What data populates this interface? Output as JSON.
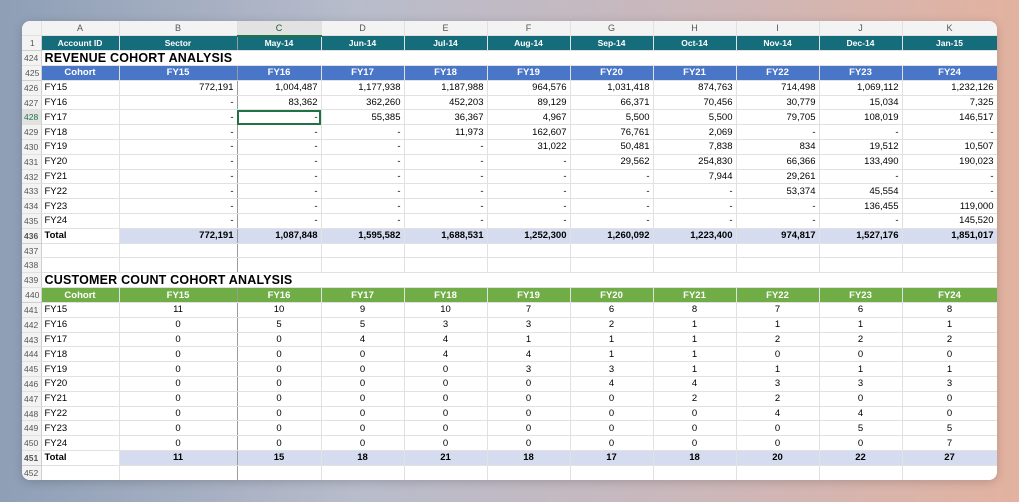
{
  "columns": [
    "A",
    "B",
    "C",
    "D",
    "E",
    "F",
    "G",
    "H",
    "I",
    "J",
    "K"
  ],
  "header_row": {
    "num": "1",
    "cells": [
      "Account ID",
      "Sector",
      "May-14",
      "Jun-14",
      "Jul-14",
      "Aug-14",
      "Sep-14",
      "Oct-14",
      "Nov-14",
      "Dec-14",
      "Jan-15"
    ]
  },
  "revenue": {
    "title_row": "424",
    "title": "REVENUE COHORT ANALYSIS",
    "header": {
      "num": "425",
      "cells": [
        "Cohort",
        "FY15",
        "FY16",
        "FY17",
        "FY18",
        "FY19",
        "FY20",
        "FY21",
        "FY22",
        "FY23",
        "FY24"
      ]
    },
    "rows": [
      {
        "num": "426",
        "cells": [
          "FY15",
          "772,191",
          "1,004,487",
          "1,177,938",
          "1,187,988",
          "964,576",
          "1,031,418",
          "874,763",
          "714,498",
          "1,069,112",
          "1,232,126"
        ]
      },
      {
        "num": "427",
        "cells": [
          "FY16",
          "-",
          "83,362",
          "362,260",
          "452,203",
          "89,129",
          "66,371",
          "70,456",
          "30,779",
          "15,034",
          "7,325"
        ]
      },
      {
        "num": "428",
        "cells": [
          "FY17",
          "-",
          "-",
          "55,385",
          "36,367",
          "4,967",
          "5,500",
          "5,500",
          "79,705",
          "108,019",
          "146,517"
        ]
      },
      {
        "num": "429",
        "cells": [
          "FY18",
          "-",
          "-",
          "-",
          "11,973",
          "162,607",
          "76,761",
          "2,069",
          "-",
          "-",
          "-"
        ]
      },
      {
        "num": "430",
        "cells": [
          "FY19",
          "-",
          "-",
          "-",
          "-",
          "31,022",
          "50,481",
          "7,838",
          "834",
          "19,512",
          "10,507"
        ]
      },
      {
        "num": "431",
        "cells": [
          "FY20",
          "-",
          "-",
          "-",
          "-",
          "-",
          "29,562",
          "254,830",
          "66,366",
          "133,490",
          "190,023"
        ]
      },
      {
        "num": "432",
        "cells": [
          "FY21",
          "-",
          "-",
          "-",
          "-",
          "-",
          "-",
          "7,944",
          "29,261",
          "-",
          "-"
        ]
      },
      {
        "num": "433",
        "cells": [
          "FY22",
          "-",
          "-",
          "-",
          "-",
          "-",
          "-",
          "-",
          "53,374",
          "45,554",
          "-"
        ]
      },
      {
        "num": "434",
        "cells": [
          "FY23",
          "-",
          "-",
          "-",
          "-",
          "-",
          "-",
          "-",
          "-",
          "136,455",
          "119,000"
        ]
      },
      {
        "num": "435",
        "cells": [
          "FY24",
          "-",
          "-",
          "-",
          "-",
          "-",
          "-",
          "-",
          "-",
          "-",
          "145,520"
        ]
      }
    ],
    "total": {
      "num": "436",
      "cells": [
        "Total",
        "772,191",
        "1,087,848",
        "1,595,582",
        "1,688,531",
        "1,252,300",
        "1,260,092",
        "1,223,400",
        "974,817",
        "1,527,176",
        "1,851,017"
      ]
    }
  },
  "blank_rows": [
    "437",
    "438"
  ],
  "customers": {
    "title_row": "439",
    "title": "CUSTOMER COUNT COHORT ANALYSIS",
    "header": {
      "num": "440",
      "cells": [
        "Cohort",
        "FY15",
        "FY16",
        "FY17",
        "FY18",
        "FY19",
        "FY20",
        "FY21",
        "FY22",
        "FY23",
        "FY24"
      ]
    },
    "rows": [
      {
        "num": "441",
        "cells": [
          "FY15",
          "11",
          "10",
          "9",
          "10",
          "7",
          "6",
          "8",
          "7",
          "6",
          "8"
        ]
      },
      {
        "num": "442",
        "cells": [
          "FY16",
          "0",
          "5",
          "5",
          "3",
          "3",
          "2",
          "1",
          "1",
          "1",
          "1"
        ]
      },
      {
        "num": "443",
        "cells": [
          "FY17",
          "0",
          "0",
          "4",
          "4",
          "1",
          "1",
          "1",
          "2",
          "2",
          "2"
        ]
      },
      {
        "num": "444",
        "cells": [
          "FY18",
          "0",
          "0",
          "0",
          "4",
          "4",
          "1",
          "1",
          "0",
          "0",
          "0"
        ]
      },
      {
        "num": "445",
        "cells": [
          "FY19",
          "0",
          "0",
          "0",
          "0",
          "3",
          "3",
          "1",
          "1",
          "1",
          "1"
        ]
      },
      {
        "num": "446",
        "cells": [
          "FY20",
          "0",
          "0",
          "0",
          "0",
          "0",
          "4",
          "4",
          "3",
          "3",
          "3"
        ]
      },
      {
        "num": "447",
        "cells": [
          "FY21",
          "0",
          "0",
          "0",
          "0",
          "0",
          "0",
          "2",
          "2",
          "0",
          "0"
        ]
      },
      {
        "num": "448",
        "cells": [
          "FY22",
          "0",
          "0",
          "0",
          "0",
          "0",
          "0",
          "0",
          "4",
          "4",
          "0"
        ]
      },
      {
        "num": "449",
        "cells": [
          "FY23",
          "0",
          "0",
          "0",
          "0",
          "0",
          "0",
          "0",
          "0",
          "5",
          "5"
        ]
      },
      {
        "num": "450",
        "cells": [
          "FY24",
          "0",
          "0",
          "0",
          "0",
          "0",
          "0",
          "0",
          "0",
          "0",
          "7"
        ]
      }
    ],
    "total": {
      "num": "451",
      "cells": [
        "Total",
        "11",
        "15",
        "18",
        "21",
        "18",
        "17",
        "18",
        "20",
        "22",
        "27"
      ]
    }
  },
  "last_row": "452",
  "selection": {
    "row": "428",
    "column": "C"
  },
  "colors": {
    "teal_header": "#156d7b",
    "blue_header": "#4a76c7",
    "green_header": "#70ad47",
    "total_fill": "#d6dcf0",
    "selection": "#217346"
  }
}
